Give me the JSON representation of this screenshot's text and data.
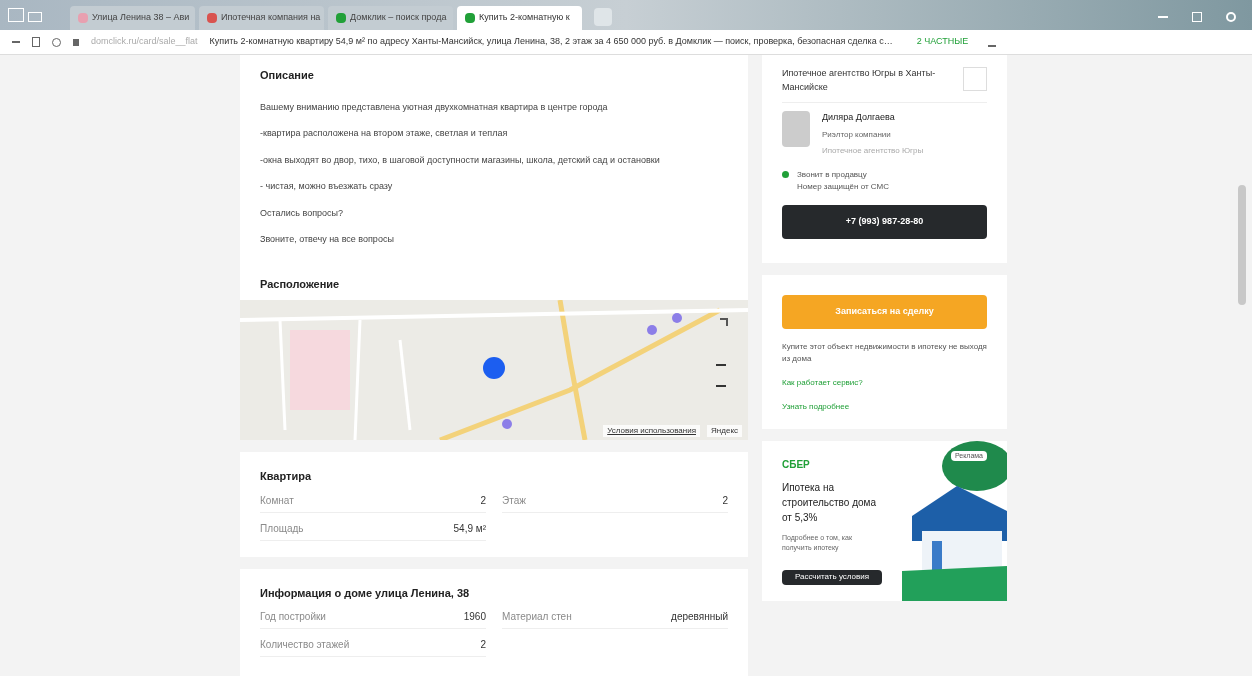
{
  "browser": {
    "tabs": [
      {
        "title": "Улица Ленина 38 – Ави",
        "selected": false,
        "color": "#e8a0b0"
      },
      {
        "title": "Ипотечная компания на",
        "selected": false,
        "color": "#d9534f"
      },
      {
        "title": "Домклик – поиск прода",
        "selected": false,
        "color": "#21a038"
      },
      {
        "title": "Купить 2-комнатную к",
        "selected": true,
        "color": "#21a038"
      }
    ],
    "url": "Купить 2-комнатную квартиру 54,9 м² по адресу Ханты-Мансийск, улица Ленина, 38, 2 этаж за 4 650 000 руб. в Домклик — поиск, проверка, безопасная сделка с…",
    "address_hint": "domclick.ru/card/sale__flat",
    "reading_badge": "2 ЧАСТНЫЕ"
  },
  "description": {
    "title": "Описание",
    "paragraphs": [
      "Вашему вниманию представлена уютная двухкомнатная квартира в центре города",
      "-квартира расположена на втором этаже, светлая и теплая",
      "-окна выходят во двор, тихо, в шаговой доступности магазины, школа, детский сад и остановки",
      "- чистая, можно въезжать сразу",
      "Остались вопросы?",
      "Звоните, отвечу на все вопросы"
    ]
  },
  "location": {
    "title": "Расположение",
    "map_attribution": "Условия использования",
    "map_brand": "Яндекс"
  },
  "apartment": {
    "title": "Квартира",
    "rows": [
      {
        "label": "Комнат",
        "value": "2"
      },
      {
        "label": "Этаж",
        "value": "2"
      },
      {
        "label": "Площадь",
        "value": "54,9 м²"
      }
    ]
  },
  "house": {
    "title": "Информация о доме улица Ленина, 38",
    "rows": [
      {
        "label": "Год постройки",
        "value": "1960"
      },
      {
        "label": "Материал стен",
        "value": "деревянный"
      },
      {
        "label": "Количество этажей",
        "value": "2"
      }
    ]
  },
  "agent_card": {
    "agency": "Ипотечное агентство Югры в Ханты-Мансийске",
    "name": "Диляра Долгаева",
    "role": "Риэлтор компании",
    "note": "Ипотечное агентство Югры",
    "status": "Звонит в продавцу",
    "status_note": "Номер защищён от СМС",
    "phone": "+7 (993) 987-28-80"
  },
  "deal_card": {
    "button": "Записаться на сделку",
    "text": "Купите этот объект недвижимости в ипотеку не выходя из дома",
    "links": [
      "Как работает сервис?",
      "Узнать подробнее"
    ]
  },
  "ad": {
    "brand": "СБЕР",
    "title": "Ипотека на строительство дома от 5,3%",
    "text": "Подробнее о том, как получить ипотеку",
    "badge": "Реклама",
    "button": "Рассчитать условия"
  }
}
